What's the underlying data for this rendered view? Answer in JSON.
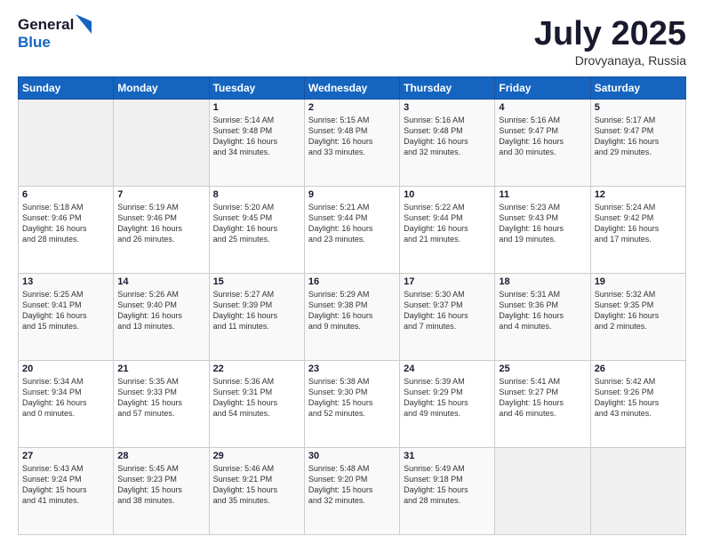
{
  "logo": {
    "line1": "General",
    "line2": "Blue"
  },
  "title": "July 2025",
  "location": "Drovyanaya, Russia",
  "days_header": [
    "Sunday",
    "Monday",
    "Tuesday",
    "Wednesday",
    "Thursday",
    "Friday",
    "Saturday"
  ],
  "weeks": [
    [
      {
        "day": "",
        "content": ""
      },
      {
        "day": "",
        "content": ""
      },
      {
        "day": "1",
        "content": "Sunrise: 5:14 AM\nSunset: 9:48 PM\nDaylight: 16 hours\nand 34 minutes."
      },
      {
        "day": "2",
        "content": "Sunrise: 5:15 AM\nSunset: 9:48 PM\nDaylight: 16 hours\nand 33 minutes."
      },
      {
        "day": "3",
        "content": "Sunrise: 5:16 AM\nSunset: 9:48 PM\nDaylight: 16 hours\nand 32 minutes."
      },
      {
        "day": "4",
        "content": "Sunrise: 5:16 AM\nSunset: 9:47 PM\nDaylight: 16 hours\nand 30 minutes."
      },
      {
        "day": "5",
        "content": "Sunrise: 5:17 AM\nSunset: 9:47 PM\nDaylight: 16 hours\nand 29 minutes."
      }
    ],
    [
      {
        "day": "6",
        "content": "Sunrise: 5:18 AM\nSunset: 9:46 PM\nDaylight: 16 hours\nand 28 minutes."
      },
      {
        "day": "7",
        "content": "Sunrise: 5:19 AM\nSunset: 9:46 PM\nDaylight: 16 hours\nand 26 minutes."
      },
      {
        "day": "8",
        "content": "Sunrise: 5:20 AM\nSunset: 9:45 PM\nDaylight: 16 hours\nand 25 minutes."
      },
      {
        "day": "9",
        "content": "Sunrise: 5:21 AM\nSunset: 9:44 PM\nDaylight: 16 hours\nand 23 minutes."
      },
      {
        "day": "10",
        "content": "Sunrise: 5:22 AM\nSunset: 9:44 PM\nDaylight: 16 hours\nand 21 minutes."
      },
      {
        "day": "11",
        "content": "Sunrise: 5:23 AM\nSunset: 9:43 PM\nDaylight: 16 hours\nand 19 minutes."
      },
      {
        "day": "12",
        "content": "Sunrise: 5:24 AM\nSunset: 9:42 PM\nDaylight: 16 hours\nand 17 minutes."
      }
    ],
    [
      {
        "day": "13",
        "content": "Sunrise: 5:25 AM\nSunset: 9:41 PM\nDaylight: 16 hours\nand 15 minutes."
      },
      {
        "day": "14",
        "content": "Sunrise: 5:26 AM\nSunset: 9:40 PM\nDaylight: 16 hours\nand 13 minutes."
      },
      {
        "day": "15",
        "content": "Sunrise: 5:27 AM\nSunset: 9:39 PM\nDaylight: 16 hours\nand 11 minutes."
      },
      {
        "day": "16",
        "content": "Sunrise: 5:29 AM\nSunset: 9:38 PM\nDaylight: 16 hours\nand 9 minutes."
      },
      {
        "day": "17",
        "content": "Sunrise: 5:30 AM\nSunset: 9:37 PM\nDaylight: 16 hours\nand 7 minutes."
      },
      {
        "day": "18",
        "content": "Sunrise: 5:31 AM\nSunset: 9:36 PM\nDaylight: 16 hours\nand 4 minutes."
      },
      {
        "day": "19",
        "content": "Sunrise: 5:32 AM\nSunset: 9:35 PM\nDaylight: 16 hours\nand 2 minutes."
      }
    ],
    [
      {
        "day": "20",
        "content": "Sunrise: 5:34 AM\nSunset: 9:34 PM\nDaylight: 16 hours\nand 0 minutes."
      },
      {
        "day": "21",
        "content": "Sunrise: 5:35 AM\nSunset: 9:33 PM\nDaylight: 15 hours\nand 57 minutes."
      },
      {
        "day": "22",
        "content": "Sunrise: 5:36 AM\nSunset: 9:31 PM\nDaylight: 15 hours\nand 54 minutes."
      },
      {
        "day": "23",
        "content": "Sunrise: 5:38 AM\nSunset: 9:30 PM\nDaylight: 15 hours\nand 52 minutes."
      },
      {
        "day": "24",
        "content": "Sunrise: 5:39 AM\nSunset: 9:29 PM\nDaylight: 15 hours\nand 49 minutes."
      },
      {
        "day": "25",
        "content": "Sunrise: 5:41 AM\nSunset: 9:27 PM\nDaylight: 15 hours\nand 46 minutes."
      },
      {
        "day": "26",
        "content": "Sunrise: 5:42 AM\nSunset: 9:26 PM\nDaylight: 15 hours\nand 43 minutes."
      }
    ],
    [
      {
        "day": "27",
        "content": "Sunrise: 5:43 AM\nSunset: 9:24 PM\nDaylight: 15 hours\nand 41 minutes."
      },
      {
        "day": "28",
        "content": "Sunrise: 5:45 AM\nSunset: 9:23 PM\nDaylight: 15 hours\nand 38 minutes."
      },
      {
        "day": "29",
        "content": "Sunrise: 5:46 AM\nSunset: 9:21 PM\nDaylight: 15 hours\nand 35 minutes."
      },
      {
        "day": "30",
        "content": "Sunrise: 5:48 AM\nSunset: 9:20 PM\nDaylight: 15 hours\nand 32 minutes."
      },
      {
        "day": "31",
        "content": "Sunrise: 5:49 AM\nSunset: 9:18 PM\nDaylight: 15 hours\nand 28 minutes."
      },
      {
        "day": "",
        "content": ""
      },
      {
        "day": "",
        "content": ""
      }
    ]
  ]
}
